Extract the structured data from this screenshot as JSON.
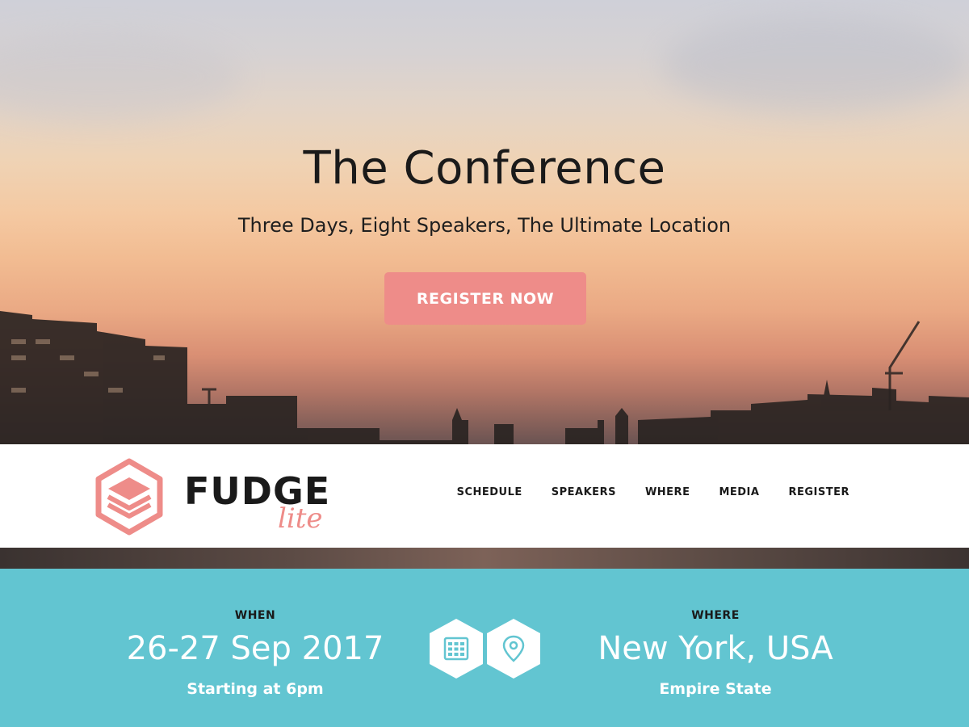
{
  "hero": {
    "title": "The Conference",
    "subtitle": "Three Days, Eight Speakers, The Ultimate Location",
    "cta_label": "REGISTER NOW"
  },
  "logo": {
    "word": "FUDGE",
    "sub": "lite"
  },
  "nav": {
    "items": [
      {
        "label": "SCHEDULE"
      },
      {
        "label": "SPEAKERS"
      },
      {
        "label": "WHERE"
      },
      {
        "label": "MEDIA"
      },
      {
        "label": "REGISTER"
      }
    ]
  },
  "info": {
    "when": {
      "label": "WHEN",
      "value": "26-27 Sep 2017",
      "detail": "Starting at 6pm"
    },
    "where": {
      "label": "WHERE",
      "value": "New York, USA",
      "detail": "Empire State"
    },
    "icons": [
      "calendar-icon",
      "map-pin-icon"
    ]
  },
  "colors": {
    "accent": "#ee8c89",
    "info_band": "#62c5d1",
    "text_dark": "#1a1a1a"
  }
}
